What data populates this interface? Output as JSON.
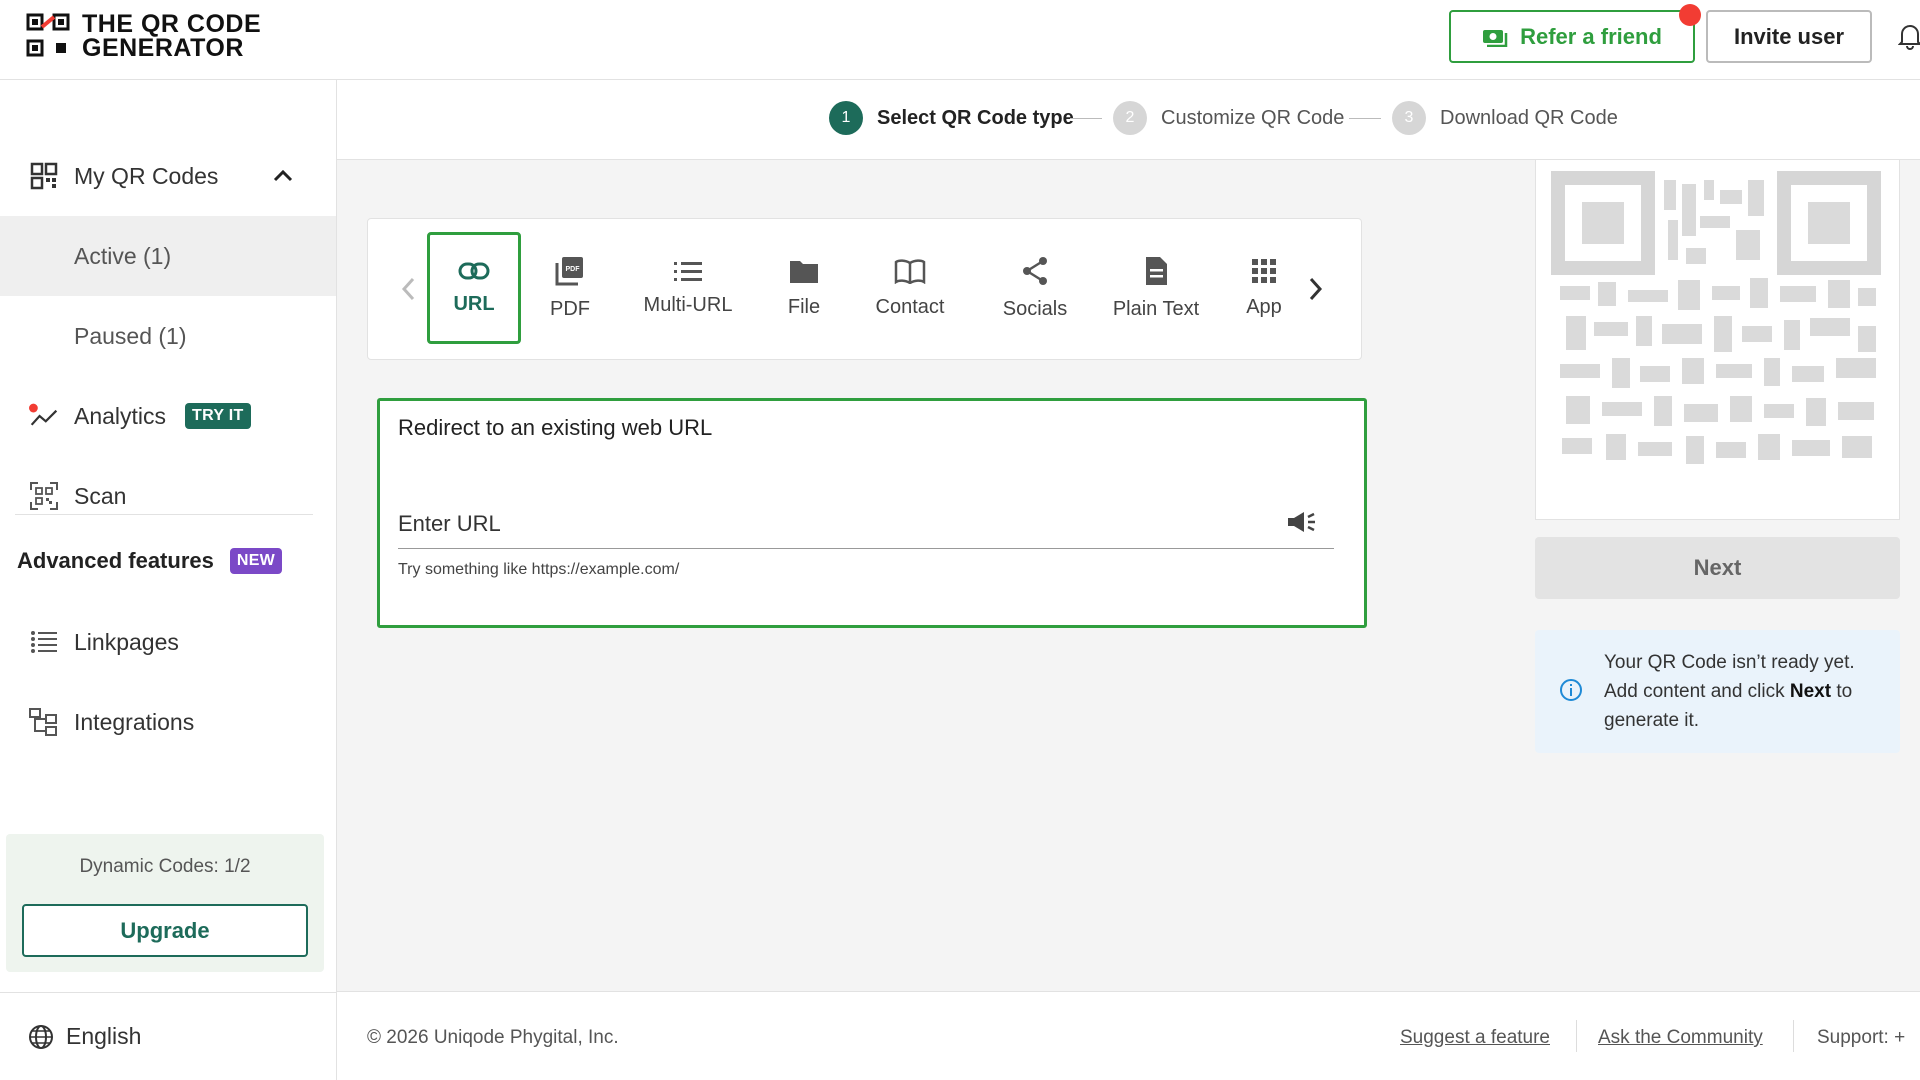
{
  "header": {
    "logo_line1": "THE QR CODE",
    "logo_line2": "GENERATOR",
    "refer_label": "Refer a friend",
    "invite_label": "Invite user"
  },
  "sidebar": {
    "my_qr_codes": "My QR Codes",
    "active": "Active (1)",
    "paused": "Paused (1)",
    "analytics": "Analytics",
    "analytics_badge": "TRY IT",
    "scan": "Scan",
    "advanced_title": "Advanced features",
    "advanced_badge": "NEW",
    "linkpages": "Linkpages",
    "integrations": "Integrations",
    "plan_text": "Dynamic Codes: 1/2",
    "upgrade_label": "Upgrade",
    "language": "English"
  },
  "stepper": {
    "steps": [
      {
        "num": "1",
        "label": "Select QR Code type"
      },
      {
        "num": "2",
        "label": "Customize QR Code"
      },
      {
        "num": "3",
        "label": "Download QR Code"
      }
    ]
  },
  "types": {
    "items": [
      {
        "label": "URL",
        "icon": "link-icon"
      },
      {
        "label": "PDF",
        "icon": "pdf-icon"
      },
      {
        "label": "Multi-URL",
        "icon": "list-icon"
      },
      {
        "label": "File",
        "icon": "folder-icon"
      },
      {
        "label": "Contact",
        "icon": "contact-book-icon"
      },
      {
        "label": "Socials",
        "icon": "share-icon"
      },
      {
        "label": "Plain Text",
        "icon": "document-icon"
      },
      {
        "label": "App",
        "icon": "grid-icon"
      }
    ],
    "selected": "URL"
  },
  "form": {
    "title": "Redirect to an existing web URL",
    "input_placeholder": "Enter URL",
    "input_value": "",
    "hint": "Try something like https://example.com/"
  },
  "right_panel": {
    "next_label": "Next",
    "info_prefix": "Your QR Code isn’t ready yet. Add content and click ",
    "info_bold": "Next",
    "info_suffix": " to generate it."
  },
  "footer": {
    "copyright": "© 2026 Uniqode Phygital, Inc.",
    "suggest": "Suggest a feature",
    "community": "Ask the Community",
    "support": "Support: +"
  },
  "colors": {
    "brand_green": "#2f9e3e",
    "dark_teal": "#1d6b5a",
    "new_purple": "#7b49c7",
    "notification_red": "#f23c33",
    "info_blue": "#1f8ad6"
  }
}
